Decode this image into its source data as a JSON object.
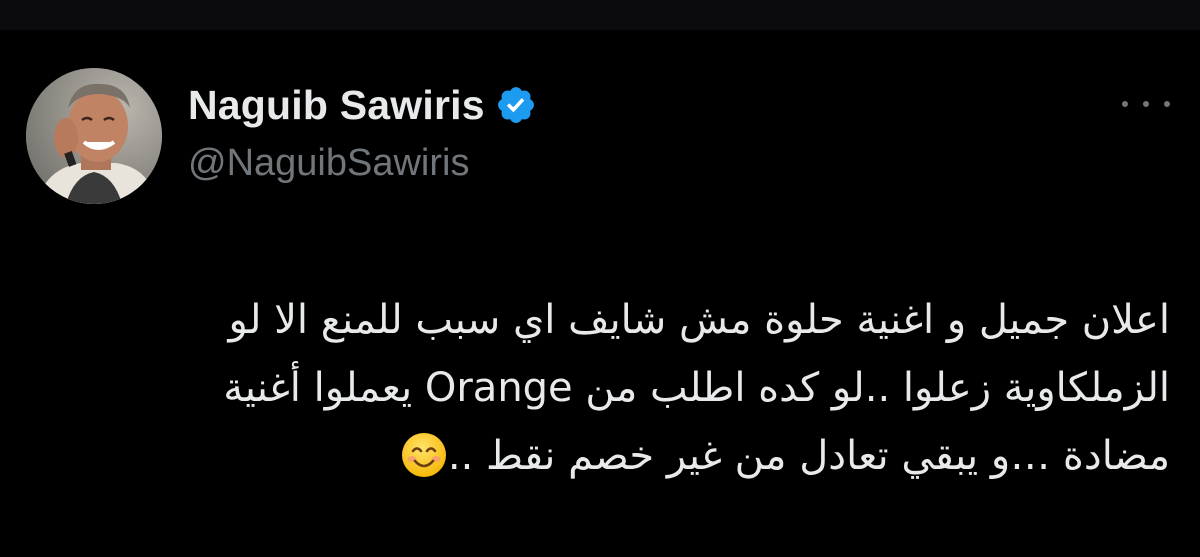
{
  "colors": {
    "background": "#000000",
    "text_primary": "#e7e9ea",
    "text_secondary": "#71767b",
    "verified_blue": "#1d9bf0"
  },
  "author": {
    "display_name": "Naguib Sawiris",
    "handle": "@NaguibSawiris",
    "verified": true,
    "avatar_icon": "profile-photo"
  },
  "actions": {
    "more_icon": "more-horizontal-icon"
  },
  "tweet": {
    "lines": [
      "اعلان جميل و اغنية حلوة مش شايف اي سبب للمنع الا لو",
      "الزملكاوية زعلوا ..لو كده اطلب من Orange يعملوا أغنية",
      "مضادة …و يبقي تعادل من غير خصم نقط .."
    ],
    "emoji": "smiling-face-with-smiling-eyes"
  }
}
